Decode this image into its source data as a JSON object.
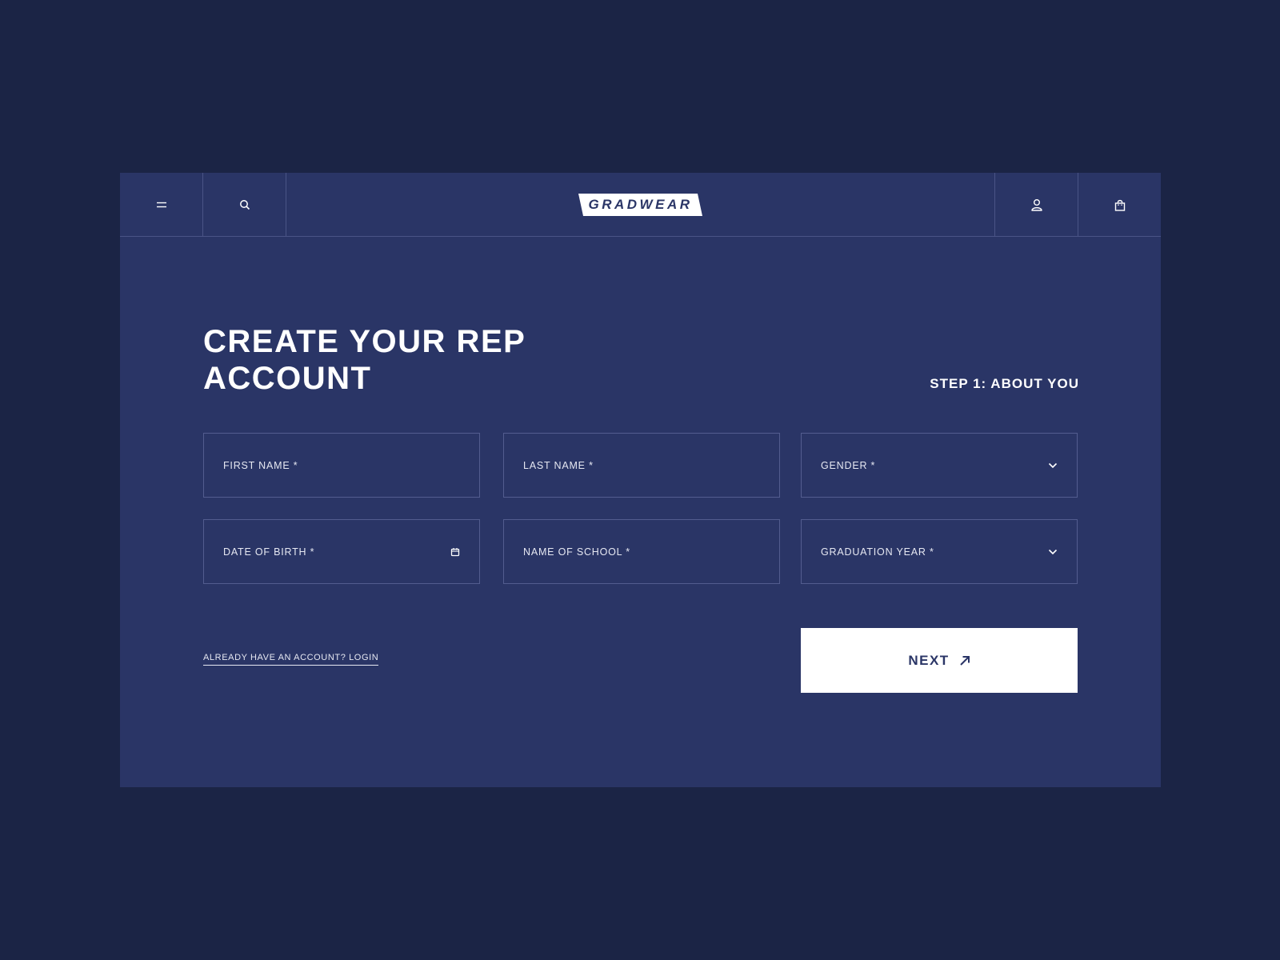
{
  "header": {
    "logo_text": "GRADWEAR",
    "icons": {
      "menu": "hamburger-menu-icon",
      "search": "search-icon",
      "account": "user-icon",
      "bag": "shopping-bag-icon"
    }
  },
  "form": {
    "title": "CREATE YOUR REP ACCOUNT",
    "step": "STEP 1: ABOUT YOU",
    "fields": {
      "first_name": "FIRST NAME *",
      "last_name": "LAST NAME *",
      "gender": "GENDER *",
      "date_of_birth": "DATE OF BIRTH *",
      "school_name": "NAME OF SCHOOL *",
      "graduation_year": "GRADUATION YEAR *"
    },
    "login_link": "ALREADY HAVE AN ACCOUNT? LOGIN",
    "next_label": "NEXT"
  },
  "colors": {
    "page_background": "#1b2445",
    "panel_background": "#2a3566",
    "border": "#535d8f",
    "button_background": "#ffffff",
    "button_text": "#2a3566"
  }
}
